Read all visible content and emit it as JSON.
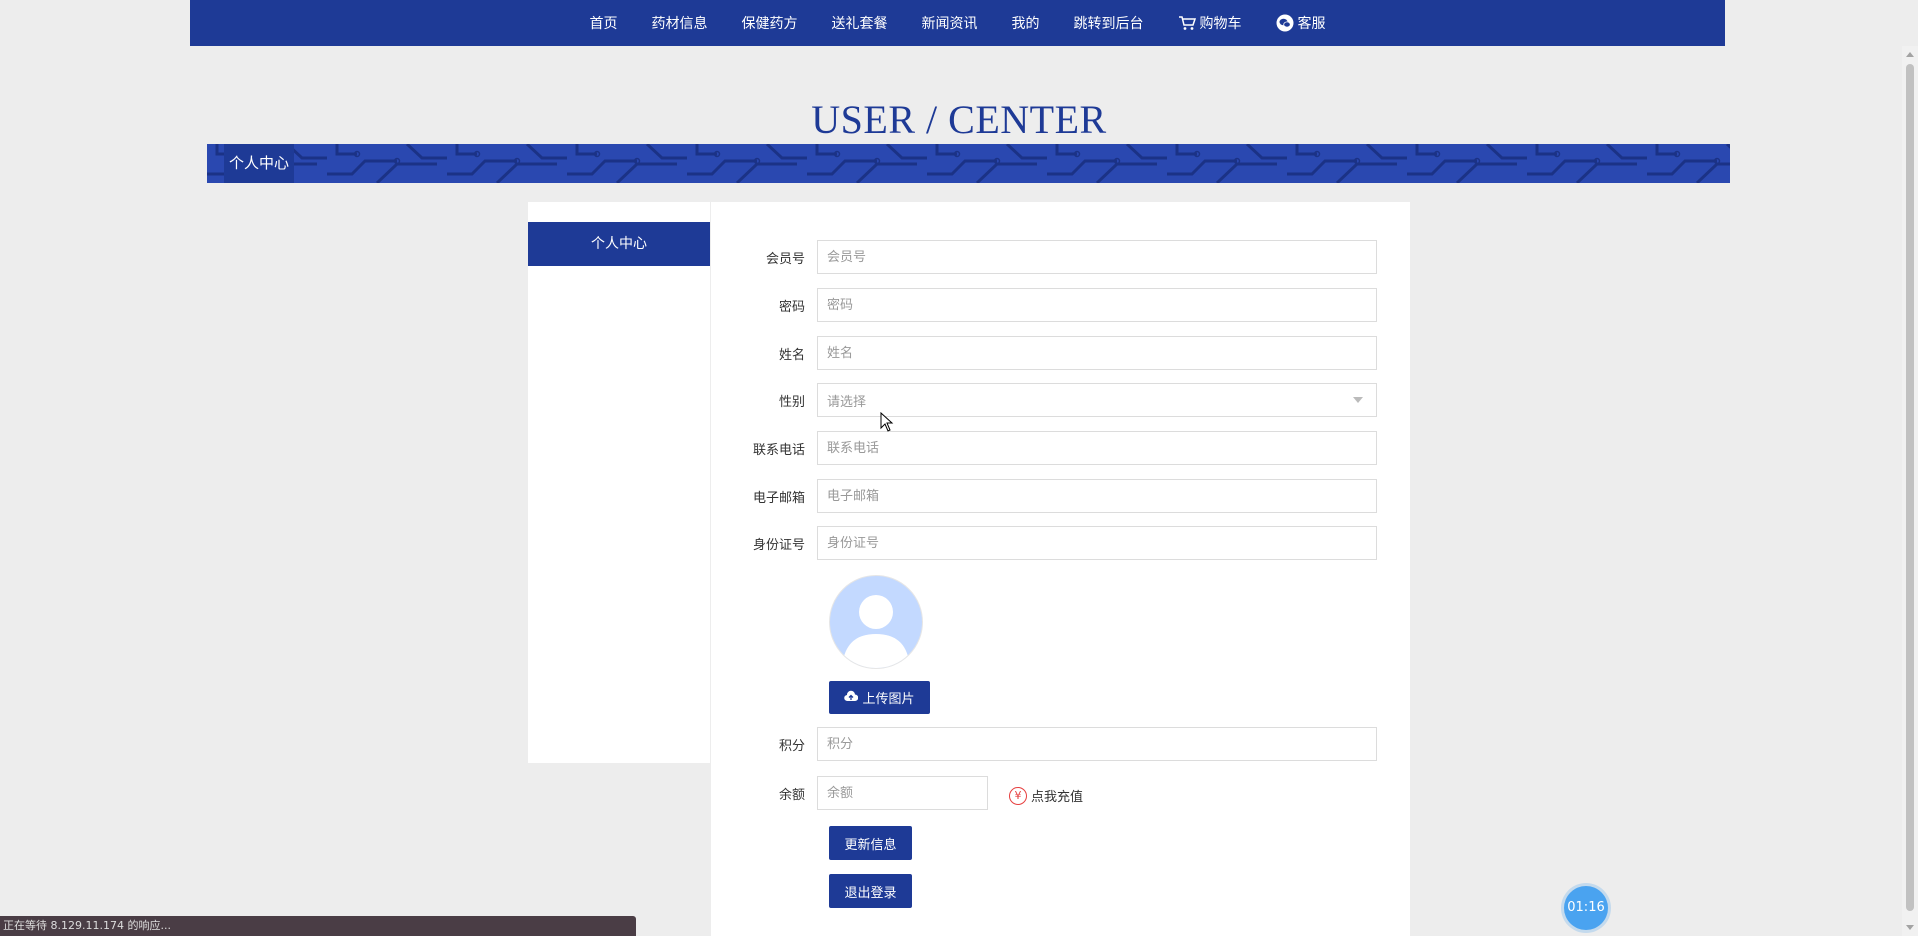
{
  "nav": {
    "items": [
      "首页",
      "药材信息",
      "保健药方",
      "送礼套餐",
      "新闻资讯",
      "我的",
      "跳转到后台"
    ],
    "cart_label": "购物车",
    "service_label": "客服"
  },
  "page_title": "USER / CENTER",
  "banner_tag": "个人中心",
  "sidebar": {
    "items": [
      {
        "label": "个人中心"
      }
    ]
  },
  "form": {
    "member_no": {
      "label": "会员号",
      "placeholder": "会员号",
      "value": ""
    },
    "password": {
      "label": "密码",
      "placeholder": "密码",
      "value": ""
    },
    "name": {
      "label": "姓名",
      "placeholder": "姓名",
      "value": ""
    },
    "gender": {
      "label": "性别",
      "placeholder": "请选择"
    },
    "phone": {
      "label": "联系电话",
      "placeholder": "联系电话",
      "value": ""
    },
    "email": {
      "label": "电子邮箱",
      "placeholder": "电子邮箱",
      "value": ""
    },
    "id_card": {
      "label": "身份证号",
      "placeholder": "身份证号",
      "value": ""
    },
    "upload_label": "上传图片",
    "points": {
      "label": "积分",
      "placeholder": "积分",
      "value": ""
    },
    "balance": {
      "label": "余额",
      "placeholder": "余额",
      "value": ""
    },
    "recharge_label": "点我充值",
    "recharge_icon": "¥",
    "update_label": "更新信息",
    "logout_label": "退出登录"
  },
  "timer": "01:16",
  "status_text": "正在等待 8.129.11.174 的响应...",
  "colors": {
    "primary": "#1e3a96",
    "banner": "#2a48b0",
    "avatar": "#c3d9ff",
    "timer": "#4aa3f0"
  }
}
